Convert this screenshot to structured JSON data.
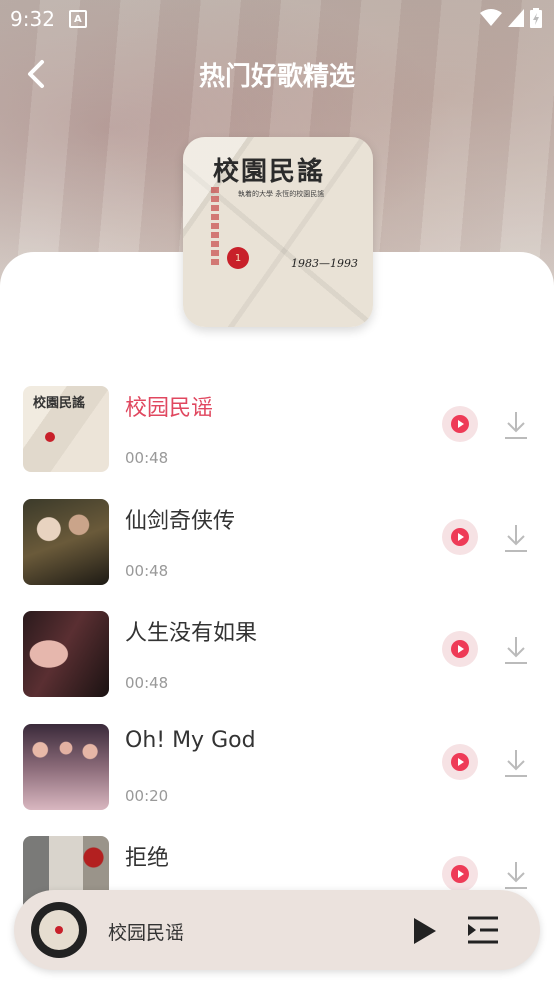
{
  "status_bar": {
    "time": "9:32",
    "notif_icon": "A"
  },
  "header": {
    "title": "热门好歌精选"
  },
  "album_cover": {
    "title": "校園民謠",
    "subtitle": "執着的大學  永恆的校園民謠",
    "years": "1983—1993",
    "dot": "1"
  },
  "songs": [
    {
      "title": "校园民谣",
      "duration": "00:48",
      "active": true,
      "thumb": "campus"
    },
    {
      "title": "仙剑奇侠传",
      "duration": "00:48",
      "active": false,
      "thumb": "xianjian"
    },
    {
      "title": "人生没有如果",
      "duration": "00:48",
      "active": false,
      "thumb": "rensheng"
    },
    {
      "title": "Oh! My God",
      "duration": "00:20",
      "active": false,
      "thumb": "ohmygod"
    },
    {
      "title": "拒绝",
      "duration": "",
      "active": false,
      "thumb": "jujue"
    }
  ],
  "mini_player": {
    "title": "校园民谣"
  },
  "colors": {
    "accent": "#e0475f",
    "play_red": "#ee3b57",
    "mini_bg": "#ebe2dd"
  }
}
